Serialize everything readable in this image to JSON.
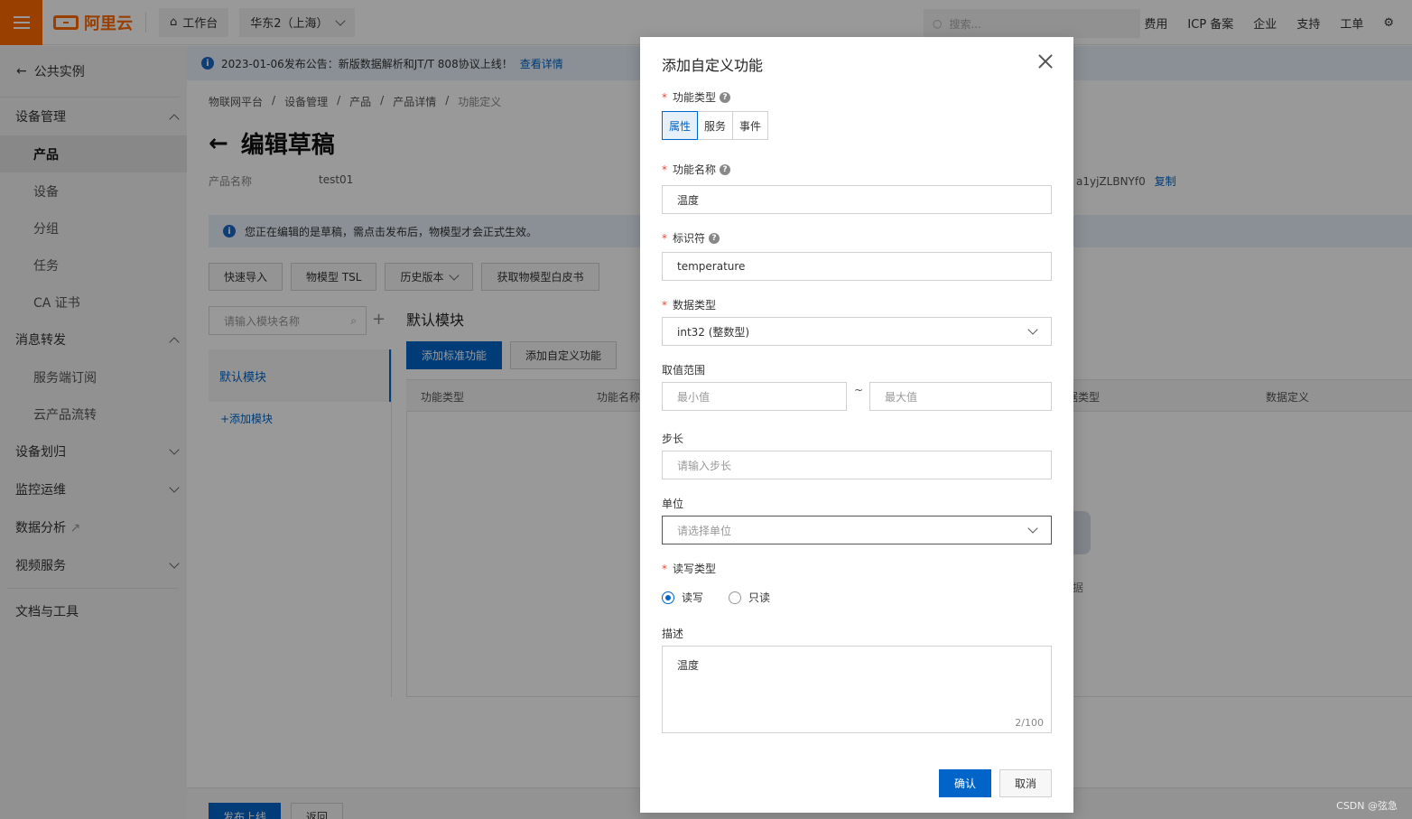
{
  "topbar": {
    "logo_text": "阿里云",
    "workbench": "工作台",
    "region": "华东2（上海）",
    "search_placeholder": "搜索...",
    "links": [
      "费用",
      "ICP 备案",
      "企业",
      "支持",
      "工单"
    ]
  },
  "sidebar": {
    "back": "公共实例",
    "groups": [
      {
        "label": "设备管理",
        "items": [
          "产品",
          "设备",
          "分组",
          "任务",
          "CA 证书"
        ]
      },
      {
        "label": "消息转发",
        "items": [
          "服务端订阅",
          "云产品流转"
        ]
      },
      {
        "label": "设备划归"
      },
      {
        "label": "监控运维"
      },
      {
        "label": "数据分析"
      },
      {
        "label": "视频服务"
      },
      {
        "label": "文档与工具"
      }
    ],
    "active_item": "产品"
  },
  "notice": {
    "text": "2023-01-06发布公告：新版数据解析和JT/T 808协议上线！",
    "link": "查看详情"
  },
  "breadcrumb": [
    "物联网平台",
    "设备管理",
    "产品",
    "产品详情",
    "功能定义"
  ],
  "page": {
    "title": "编辑草稿",
    "product_label": "产品名称",
    "product_name": "test01",
    "product_key": "a1yjZLBNYf0",
    "copy": "复制",
    "draft_tip": "您正在编辑的是草稿，需点击发布后，物模型才会正式生效。",
    "buttons": [
      "快速导入",
      "物模型 TSL",
      "历史版本",
      "获取物模型白皮书"
    ],
    "module_search_placeholder": "请输入模块名称",
    "module_item": "默认模块",
    "add_module": "+添加模块",
    "module_title": "默认模块",
    "add_std": "添加标准功能",
    "add_custom": "添加自定义功能",
    "table_headers": [
      "功能类型",
      "功能名称",
      "数据类型",
      "数据定义"
    ],
    "empty_tail": "据",
    "publish": "发布上线",
    "back": "返回"
  },
  "modal": {
    "title": "添加自定义功能",
    "func_type_label": "功能类型",
    "func_types": [
      "属性",
      "服务",
      "事件"
    ],
    "func_type_selected": "属性",
    "name_label": "功能名称",
    "name_value": "温度",
    "id_label": "标识符",
    "id_value": "temperature",
    "dtype_label": "数据类型",
    "dtype_value": "int32 (整数型)",
    "range_label": "取值范围",
    "range_min_ph": "最小值",
    "range_sep": "~",
    "range_max_ph": "最大值",
    "step_label": "步长",
    "step_ph": "请输入步长",
    "unit_label": "单位",
    "unit_ph": "请选择单位",
    "rw_label": "读写类型",
    "rw_options": [
      "读写",
      "只读"
    ],
    "rw_selected": "读写",
    "desc_label": "描述",
    "desc_value": "温度",
    "desc_counter": "2/100",
    "ok": "确认",
    "cancel": "取消"
  },
  "watermark": "CSDN @弦急",
  "colors": {
    "brand": "#ff6a00",
    "primary": "#0064c8",
    "required": "#e84738"
  }
}
